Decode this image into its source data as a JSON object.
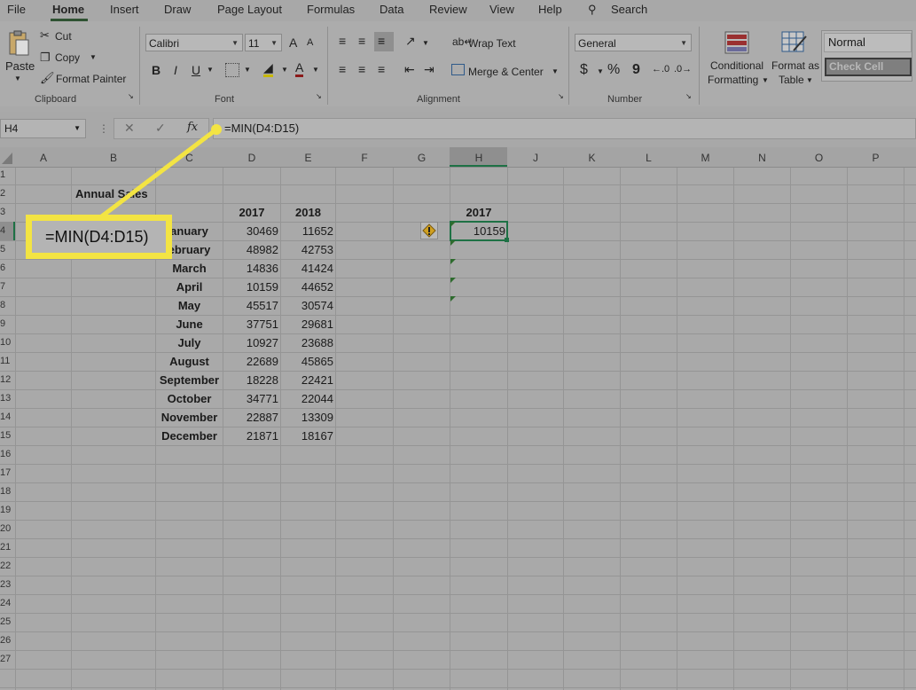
{
  "menu": [
    "File",
    "Home",
    "Insert",
    "Draw",
    "Page Layout",
    "Formulas",
    "Data",
    "Review",
    "View",
    "Help"
  ],
  "search_label": "Search",
  "clipboard": {
    "paste": "Paste",
    "cut": "Cut",
    "copy": "Copy",
    "format_painter": "Format Painter",
    "group": "Clipboard"
  },
  "font": {
    "name": "Calibri",
    "size": "11",
    "group": "Font",
    "bold": "B",
    "italic": "I",
    "underline": "U",
    "grow": "A",
    "shrink": "A"
  },
  "alignment": {
    "wrap": "Wrap Text",
    "merge": "Merge & Center",
    "group": "Alignment"
  },
  "number": {
    "format": "General",
    "currency": "$",
    "percent": "%",
    "comma": "9",
    "group": "Number"
  },
  "styles": {
    "conditional_1": "Conditional",
    "conditional_2": "Formatting",
    "format_table_1": "Format as",
    "format_table_2": "Table",
    "normal": "Normal",
    "check_cell": "Check Cell"
  },
  "formula_bar": {
    "name_box": "H4",
    "fx": "fx",
    "formula": "=MIN(D4:D15)"
  },
  "callout": "=MIN(D4:D15)",
  "columns": [
    "A",
    "B",
    "C",
    "D",
    "E",
    "F",
    "G",
    "H",
    "J",
    "K",
    "L",
    "M",
    "N",
    "O",
    "P"
  ],
  "rows": [
    "1",
    "2",
    "3",
    "4",
    "5",
    "6",
    "7",
    "8",
    "9",
    "10",
    "11",
    "12",
    "13",
    "14",
    "15",
    "16",
    "17",
    "18",
    "19",
    "20",
    "21",
    "22",
    "23",
    "24",
    "25",
    "26",
    "27"
  ],
  "sheet": {
    "title": "Annual Sales",
    "year_d": "2017",
    "year_e": "2018",
    "year_h": "2017",
    "result_h4": "10159",
    "months": [
      "anuary",
      "ebruary",
      "March",
      "April",
      "May",
      "June",
      "July",
      "August",
      "September",
      "October",
      "November",
      "December"
    ],
    "d_values": [
      "30469",
      "48982",
      "14836",
      "10159",
      "45517",
      "37751",
      "10927",
      "22689",
      "18228",
      "34771",
      "22887",
      "21871"
    ],
    "e_values": [
      "11652",
      "42753",
      "41424",
      "44652",
      "30574",
      "29681",
      "23688",
      "45865",
      "22421",
      "22044",
      "13309",
      "18167"
    ]
  },
  "colors": {
    "accent": "#2f5232",
    "callout": "#f3e443",
    "cursor": "#1e7145"
  }
}
